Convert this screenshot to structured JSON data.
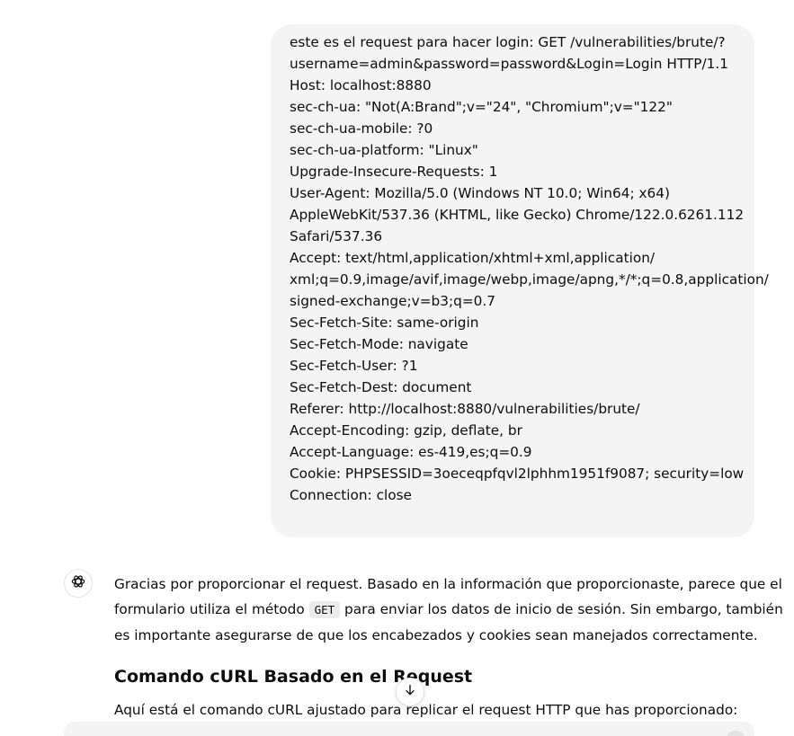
{
  "user_message": {
    "lines": [
      "este es el request para hacer login: GET /vulnerabilities/brute/?",
      "username=admin&password=password&Login=Login HTTP/1.1",
      "Host: localhost:8880",
      "sec-ch-ua: \"Not(A:Brand\";v=\"24\", \"Chromium\";v=\"122\"",
      "sec-ch-ua-mobile: ?0",
      "sec-ch-ua-platform: \"Linux\"",
      "Upgrade-Insecure-Requests: 1",
      "User-Agent: Mozilla/5.0 (Windows NT 10.0; Win64; x64)",
      "AppleWebKit/537.36 (KHTML, like Gecko) Chrome/122.0.6261.112",
      "Safari/537.36",
      "Accept: text/html,application/xhtml+xml,application/",
      "xml;q=0.9,image/avif,image/webp,image/apng,*/*;q=0.8,application/",
      "signed-exchange;v=b3;q=0.7",
      "Sec-Fetch-Site: same-origin",
      "Sec-Fetch-Mode: navigate",
      "Sec-Fetch-User: ?1",
      "Sec-Fetch-Dest: document",
      "Referer: http://localhost:8880/vulnerabilities/brute/",
      "Accept-Encoding: gzip, deflate, br",
      "Accept-Language: es-419,es;q=0.9",
      "Cookie: PHPSESSID=3oeceqpfqvl2lphhm1951f9087; security=low",
      "Connection: close"
    ]
  },
  "assistant_message": {
    "icon": "openai-logo-icon",
    "para_line1": "Gracias por proporcionar el request. Basado en la información que proporcionaste, parece que el",
    "para_line2_before": "formulario utiliza el método ",
    "para_line2_code": "GET",
    "para_line2_after": " para enviar los datos de inicio de sesión. Sin embargo, también",
    "para_line3": "es importante asegurarse de que los encabezados y cookies sean manejados correctamente.",
    "heading": "Comando cURL Basado en el Request",
    "intro": "Aquí está el comando cURL ajustado para replicar el request HTTP que has proporcionado:"
  },
  "scroll_button": {
    "icon": "arrow-down-icon"
  },
  "colors": {
    "user_bubble_bg": "#f4f4f4",
    "text": "#0d0d0d",
    "inline_code_bg": "#ececec"
  }
}
